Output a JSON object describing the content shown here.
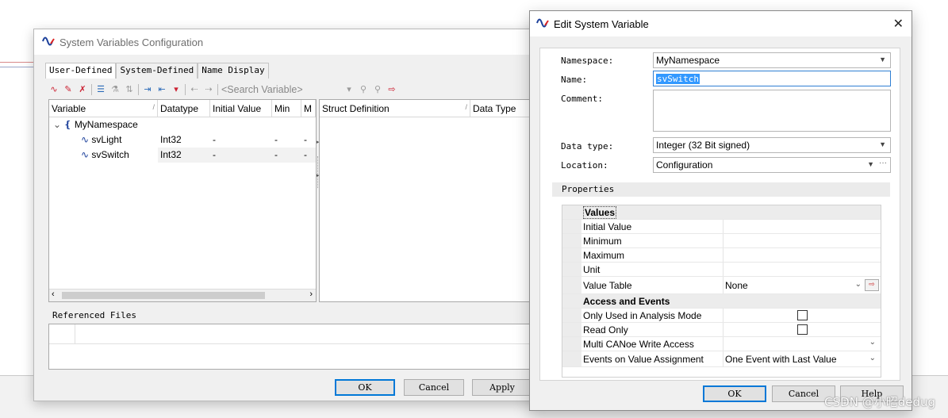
{
  "config_dialog": {
    "title": "System Variables Configuration",
    "tabs": [
      "User-Defined",
      "System-Defined",
      "Name Display"
    ],
    "search_placeholder": "<Search Variable>",
    "columns": [
      "Variable",
      "Datatype",
      "Initial Value",
      "Min",
      "M"
    ],
    "tree": {
      "namespace": "MyNamespace",
      "rows": [
        {
          "name": "svLight",
          "datatype": "Int32",
          "initial": "-",
          "min": "-",
          "max": "-"
        },
        {
          "name": "svSwitch",
          "datatype": "Int32",
          "initial": "-",
          "min": "-",
          "max": "-"
        }
      ]
    },
    "struct_columns": [
      "Struct Definition",
      "Data Type"
    ],
    "referenced_files_label": "Referenced Files",
    "buttons": {
      "ok": "OK",
      "cancel": "Cancel",
      "apply": "Apply"
    }
  },
  "edit_dialog": {
    "title": "Edit System Variable",
    "labels": {
      "namespace": "Namespace:",
      "name": "Name:",
      "comment": "Comment:",
      "data_type": "Data type:",
      "location": "Location:"
    },
    "values": {
      "namespace": "MyNamespace",
      "name": "svSwitch",
      "comment": "",
      "data_type": "Integer (32 Bit signed)",
      "location": "Configuration"
    },
    "location_more": "···",
    "properties_label": "Properties",
    "properties": {
      "values_category": "Values",
      "values_rows": [
        {
          "name": "Initial Value",
          "value": ""
        },
        {
          "name": "Minimum",
          "value": ""
        },
        {
          "name": "Maximum",
          "value": ""
        },
        {
          "name": "Unit",
          "value": ""
        },
        {
          "name": "Value Table",
          "value": "None"
        }
      ],
      "access_category": "Access and Events",
      "access_rows": [
        {
          "name": "Only Used in Analysis Mode",
          "checked": false
        },
        {
          "name": "Read Only",
          "checked": false
        },
        {
          "name": "Multi CANoe Write Access",
          "value": ""
        },
        {
          "name": "Events on Value Assignment",
          "value": "One Event with Last Value"
        }
      ]
    },
    "buttons": {
      "ok": "OK",
      "cancel": "Cancel",
      "help": "Help"
    }
  },
  "watermark": "CSDN @小昭dedug",
  "colors": {
    "accent": "#0078d7",
    "selection": "#3399ff",
    "icon_red": "#c22a3a"
  }
}
